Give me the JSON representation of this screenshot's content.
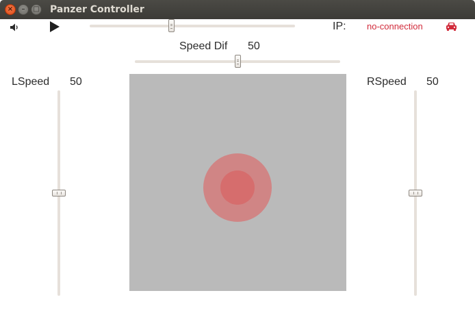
{
  "window": {
    "title": "Panzer Controller",
    "buttons": {
      "close": "×",
      "minimize": "–",
      "maximize": "□"
    }
  },
  "toolbar": {
    "volume_icon": "speaker-icon",
    "play_icon": "play-icon",
    "volume_level": 0.5,
    "ip_label": "IP:",
    "connection_status": "no-connection",
    "car_icon": "car-icon",
    "status_color": "#d12a3a"
  },
  "speed_dif": {
    "label": "Speed Dif",
    "value": "50",
    "level": 0.5
  },
  "left": {
    "label": "LSpeed",
    "value": "50",
    "level": 0.5
  },
  "right": {
    "label": "RSpeed",
    "value": "50",
    "level": 0.5
  },
  "joystick": {
    "pad_color": "#bababa",
    "knob_outer_color": "#d08585",
    "knob_inner_color": "#d66d6d"
  }
}
